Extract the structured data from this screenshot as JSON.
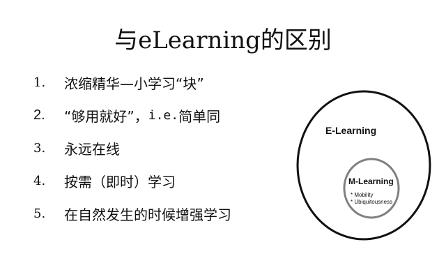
{
  "slide": {
    "title": "与eLearning的区别",
    "bullets": [
      {
        "num": "1.",
        "text": "浓缩精华—小学习“块”"
      },
      {
        "num": "2.",
        "text_a": "“够用就好”，",
        "text_mono": " i.e. ",
        "text_b": "简单同"
      },
      {
        "num": "3.",
        "text": "永远在线"
      },
      {
        "num": "4.",
        "text": "按需（即时）学习"
      },
      {
        "num": "5.",
        "text": "在自然发生的时候增强学习"
      }
    ]
  },
  "diagram": {
    "outer_label": "E-Learning",
    "inner_label": "M-Learning",
    "inner_points": [
      "* Mobility",
      "* Ubiquitousness"
    ],
    "colors": {
      "outer_stroke": "#111111",
      "inner_stroke": "#808080",
      "text": "#111111"
    }
  }
}
